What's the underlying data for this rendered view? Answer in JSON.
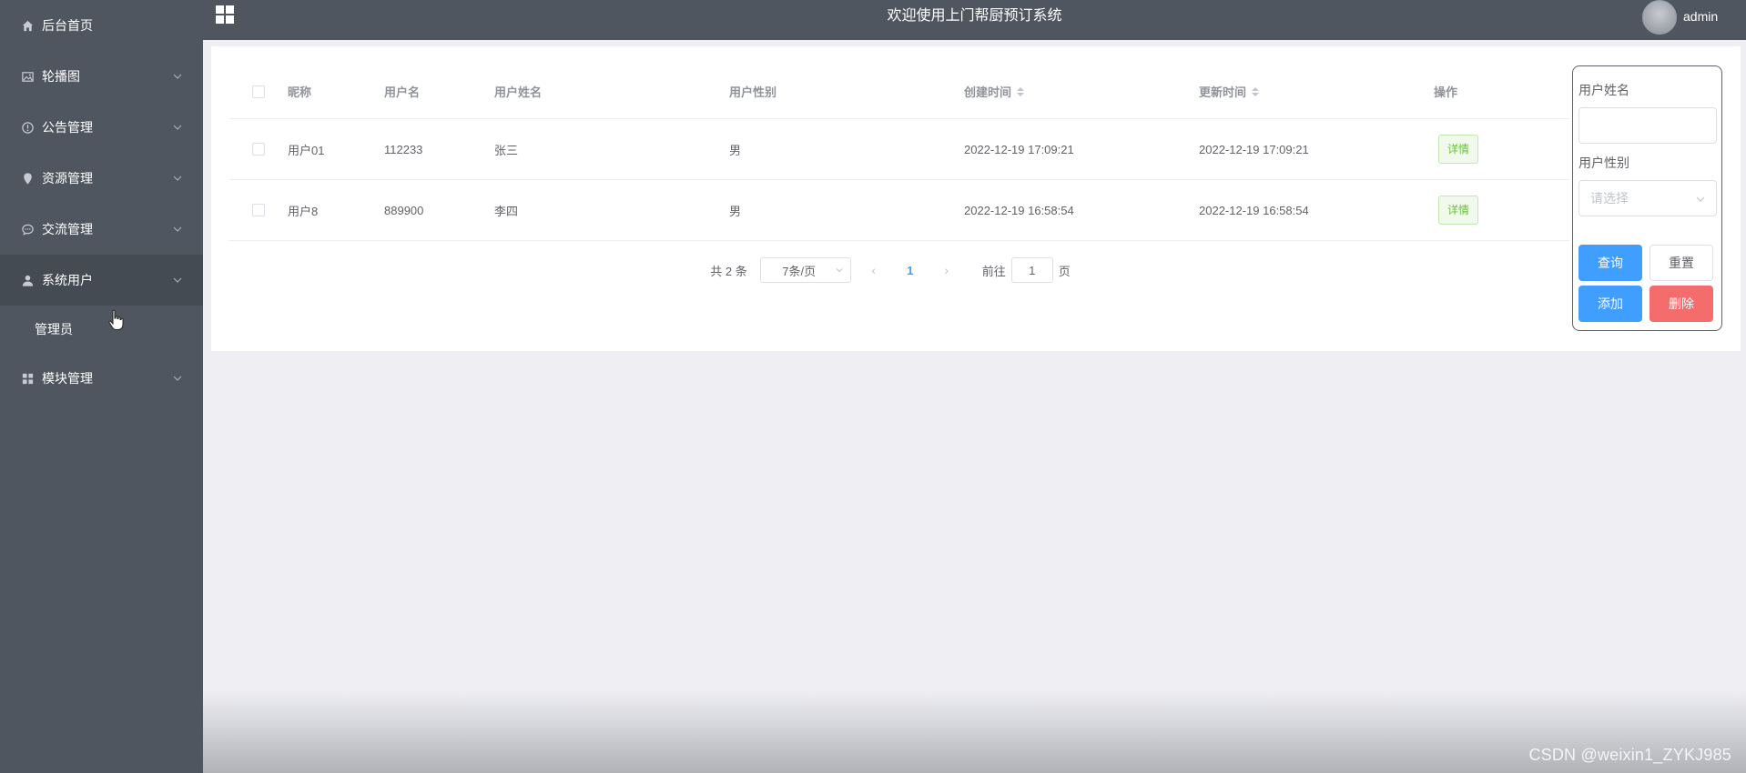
{
  "header": {
    "title": "欢迎使用上门帮厨预订系统",
    "username": "admin"
  },
  "sidebar": {
    "items": [
      {
        "label": "后台首页",
        "icon": "home-icon",
        "has_children": false
      },
      {
        "label": "轮播图",
        "icon": "picture-icon",
        "has_children": true
      },
      {
        "label": "公告管理",
        "icon": "info-icon",
        "has_children": true
      },
      {
        "label": "资源管理",
        "icon": "location-icon",
        "has_children": true
      },
      {
        "label": "交流管理",
        "icon": "chat-icon",
        "has_children": true
      },
      {
        "label": "系统用户",
        "icon": "user-icon",
        "has_children": true,
        "expanded": true
      },
      {
        "label": "模块管理",
        "icon": "grid-icon",
        "has_children": true
      }
    ],
    "sub_items": [
      {
        "label": "管理员"
      }
    ]
  },
  "table": {
    "columns": [
      "昵称",
      "用户名",
      "用户姓名",
      "用户性别",
      "创建时间",
      "更新时间",
      "操作"
    ],
    "rows": [
      {
        "nickname": "用户01",
        "username": "112233",
        "realname": "张三",
        "gender": "男",
        "created": "2022-12-19 17:09:21",
        "updated": "2022-12-19 17:09:21",
        "action": "详情"
      },
      {
        "nickname": "用户8",
        "username": "889900",
        "realname": "李四",
        "gender": "男",
        "created": "2022-12-19 16:58:54",
        "updated": "2022-12-19 16:58:54",
        "action": "详情"
      }
    ]
  },
  "pagination": {
    "total_text": "共 2 条",
    "page_size": "7条/页",
    "current_page": "1",
    "goto_label": "前往",
    "goto_value": "1",
    "page_unit": "页"
  },
  "search": {
    "name_label": "用户姓名",
    "name_value": "",
    "gender_label": "用户性别",
    "gender_placeholder": "请选择",
    "query_label": "查询",
    "reset_label": "重置",
    "add_label": "添加",
    "delete_label": "删除"
  },
  "watermark": "CSDN @weixin1_ZYKJ985",
  "colors": {
    "sidebar_bg": "#4f565f",
    "primary": "#409eff",
    "danger": "#f56c6c",
    "success": "#67c23a"
  }
}
